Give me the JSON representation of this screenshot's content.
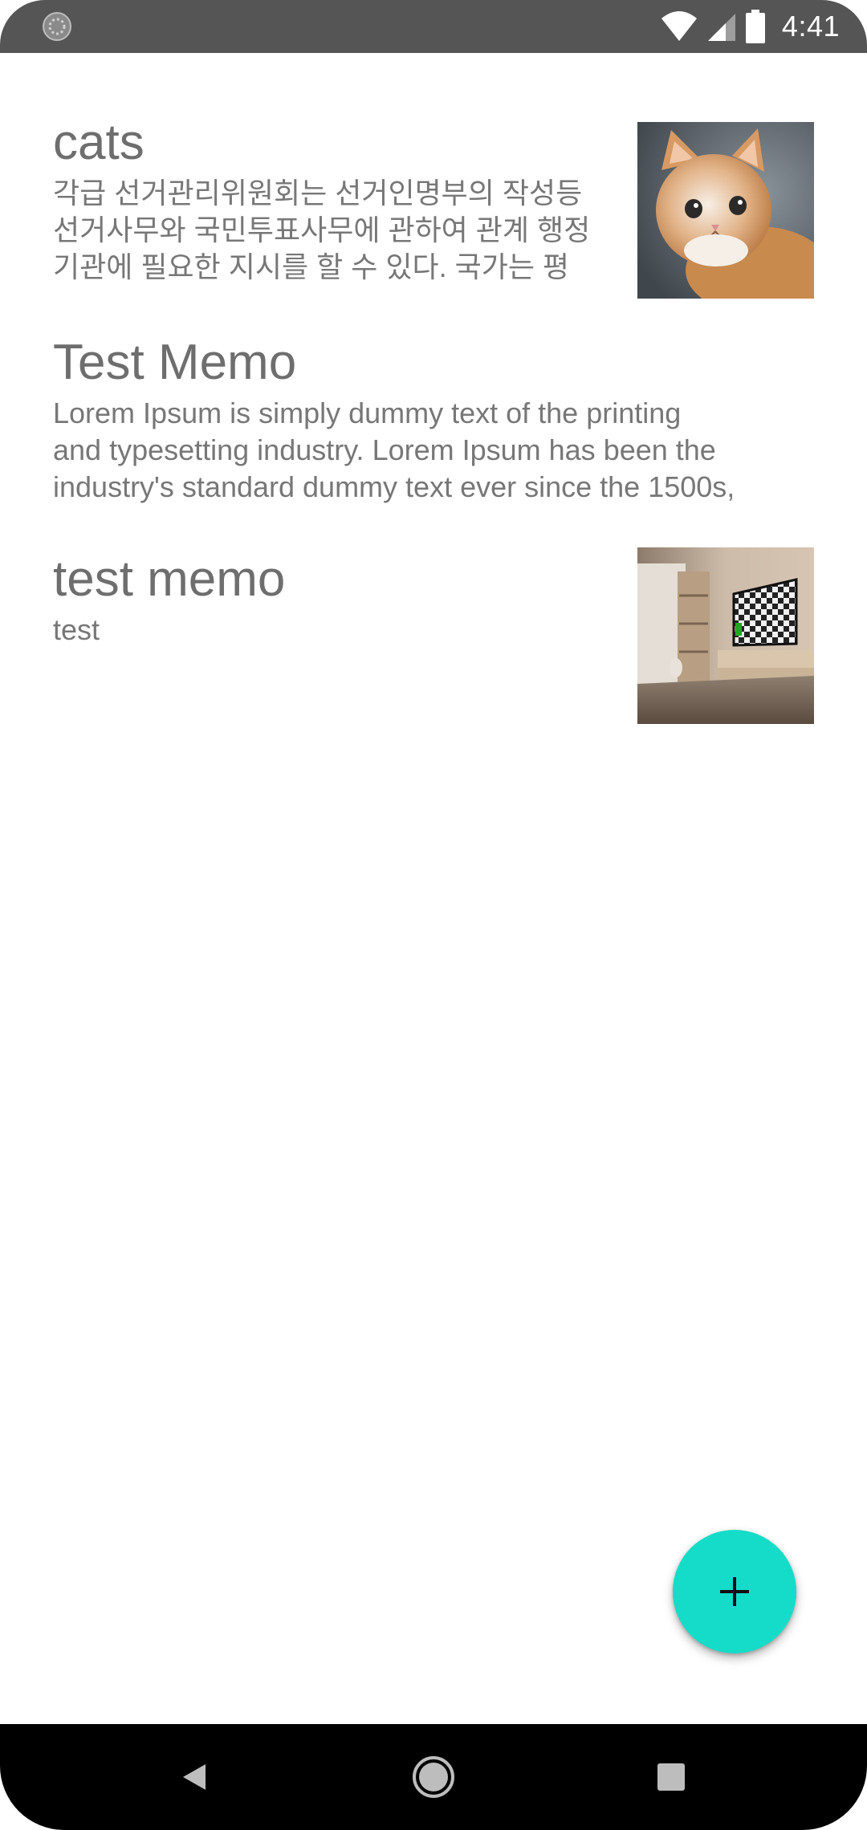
{
  "status_bar": {
    "time": "4:41"
  },
  "memos": [
    {
      "title": "cats",
      "body_lines": [
        "각급 선거관리위원회는 선거인명부의 작성등",
        "선거사무와 국민투표사무에 관하여 관계 행정",
        "기관에 필요한 지시를 할 수 있다. 국가는 평"
      ],
      "thumbnail": "kitten-photo"
    },
    {
      "title": "Test Memo",
      "body_lines": [
        "Lorem Ipsum is simply dummy text of the printing",
        "and typesetting industry. Lorem Ipsum has been the",
        "industry's standard dummy text ever since the 1500s,"
      ]
    },
    {
      "title": "test memo",
      "body_lines": [
        "test"
      ],
      "thumbnail": "room-tv-photo"
    }
  ],
  "fab": {
    "icon": "plus-icon",
    "color": "#14dcc8"
  },
  "nav_bar": {
    "buttons": [
      "back-icon",
      "home-icon",
      "recents-icon"
    ]
  }
}
